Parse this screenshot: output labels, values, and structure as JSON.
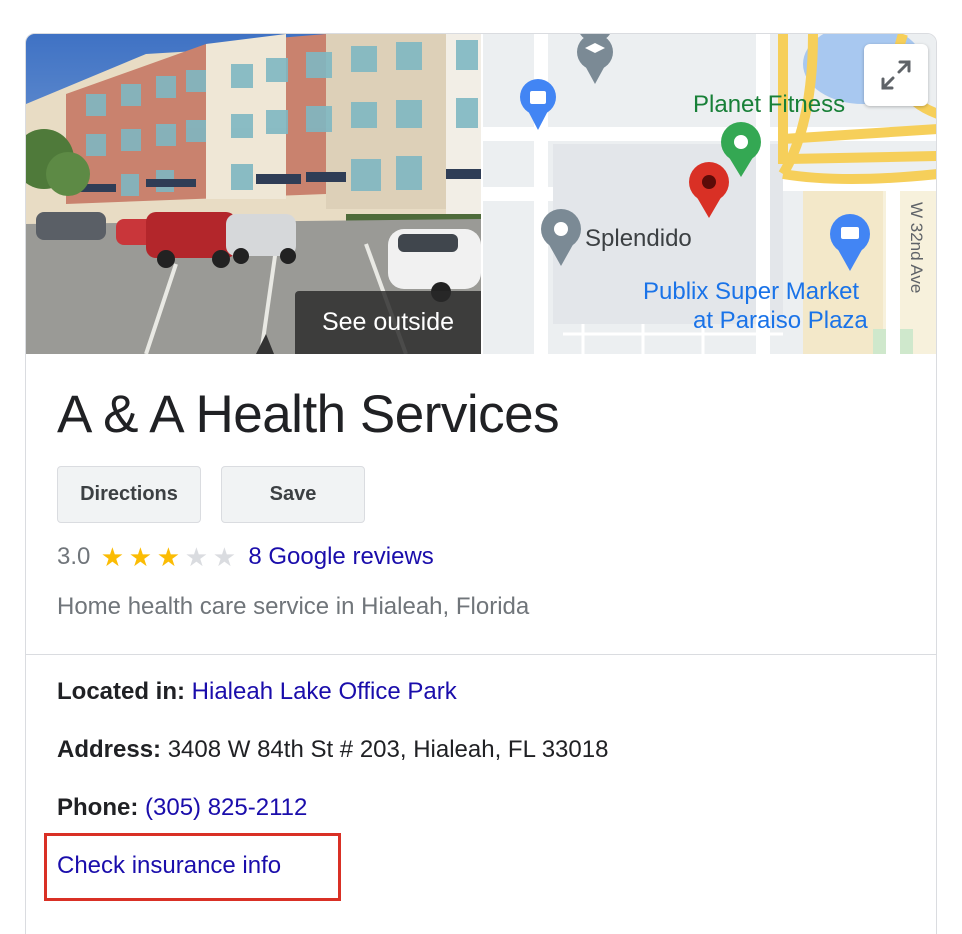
{
  "media": {
    "see_outside_label": "See outside",
    "map_labels": {
      "planet_fitness": "Planet Fitness",
      "splendido": "Splendido",
      "publix_line1": "Publix Super Market",
      "publix_line2": "at Paraiso Plaza",
      "street": "W 32nd Ave"
    },
    "expand_icon": "expand-icon"
  },
  "business": {
    "name": "A & A Health Services",
    "directions_label": "Directions",
    "save_label": "Save",
    "rating": "3.0",
    "stars_filled": 3,
    "stars_total": 5,
    "reviews_link": "8 Google reviews",
    "category": "Home health care service in Hialeah, Florida"
  },
  "details": {
    "located_in_label": "Located in:",
    "located_in_value": "Hialeah Lake Office Park",
    "address_label": "Address:",
    "address_value": "3408 W 84th St # 203, Hialeah, FL 33018",
    "phone_label": "Phone:",
    "phone_value": "(305) 825-2112",
    "insurance_link": "Check insurance info"
  },
  "colors": {
    "link": "#1a0dab",
    "star": "#fbbc04",
    "highlight_box": "#d93025",
    "map_pin_red": "#d93025",
    "map_pin_green": "#34a853",
    "map_pin_blue": "#4285f4"
  }
}
